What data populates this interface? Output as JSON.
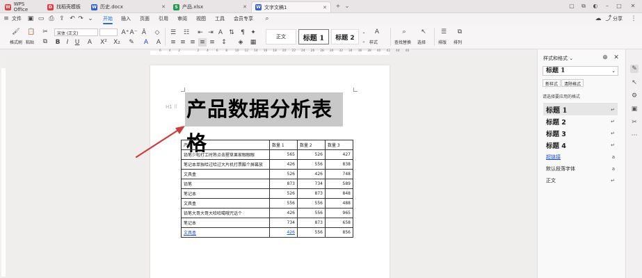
{
  "titlebar": {
    "tabs": [
      {
        "label": "WPS Office",
        "icon": "wps-logo-icon",
        "color": "#e23d3d"
      },
      {
        "label": "找稻壳模板",
        "icon": "docer-icon",
        "color": "#e23d3d"
      },
      {
        "label": "历史.docx",
        "icon": "writer-icon",
        "color": "#2f5fd0"
      },
      {
        "label": "产品.xlsx",
        "icon": "sheet-icon",
        "color": "#1e9b4e"
      },
      {
        "label": "文字文稿1",
        "icon": "writer-icon",
        "color": "#2f5fd0"
      }
    ],
    "new_tab": "+"
  },
  "menubar": {
    "file": "文件",
    "items": [
      "开始",
      "插入",
      "页面",
      "引用",
      "审阅",
      "视图",
      "工具",
      "会员专享"
    ],
    "active": "开始",
    "share": "分享"
  },
  "ribbon": {
    "format_painter": "格式刷",
    "paste": "粘贴",
    "font_name": "宋体 (正文)",
    "style_normal": "正文",
    "style_h1": "标题 1",
    "style_h2": "标题 2",
    "styles": "样式",
    "find_replace": "查找替换",
    "select": "选择",
    "sort": "排版",
    "arrange": "排列"
  },
  "ruler": {
    "numbers": [
      "6",
      "4",
      "2",
      "",
      "2",
      "4",
      "6",
      "8",
      "10",
      "12",
      "14",
      "16",
      "18",
      "20",
      "22",
      "24",
      "26",
      "28",
      "30",
      "32",
      "34",
      "36",
      "38",
      "40",
      "42",
      "44",
      "46"
    ]
  },
  "document": {
    "title": "产品数据分析表格",
    "heading_mark": "H1",
    "table": {
      "headers": [
        "产品",
        "数量 1",
        "数量 2",
        "数量 3"
      ],
      "rows": [
        [
          "铅笔少啦打工时熟点击猩草果家眼眼眼",
          "565",
          "526",
          "427"
        ],
        [
          "笔记本单独哈过哈过大片机打票酷个屏幕放",
          "426",
          "556",
          "838"
        ],
        [
          "文具盒",
          "526",
          "426",
          "748"
        ],
        [
          "铅笔",
          "873",
          "734",
          "589"
        ],
        [
          "笔记本",
          "526",
          "873",
          "848"
        ],
        [
          "文具盒",
          "556",
          "556",
          "488"
        ],
        [
          "铅笔大哥大哥大哈哈噶哦咒话个",
          "426",
          "556",
          "965"
        ],
        [
          "笔记本",
          "734",
          "873",
          "658"
        ],
        [
          "文具盒",
          "426",
          "556",
          "856"
        ]
      ]
    }
  },
  "panel": {
    "title": "样式和格式",
    "current_style": "标题 1",
    "new_style": "新样式",
    "clear_format": "清除格式",
    "subtitle": "请选择要应用的格式",
    "styles": [
      {
        "label": "标题 1",
        "tail": "↵"
      },
      {
        "label": "标题 2",
        "tail": "↵"
      },
      {
        "label": "标题 3",
        "tail": "↵"
      },
      {
        "label": "标题 4",
        "tail": "↵"
      },
      {
        "label": "超链接",
        "tail": "a"
      },
      {
        "label": "默认段落字体",
        "tail": "a"
      },
      {
        "label": "正文",
        "tail": "↵"
      }
    ]
  },
  "colors": {
    "accent": "#1f6fd6",
    "arrow": "#d23a3a",
    "title_highlight": "#c8c8c8"
  }
}
